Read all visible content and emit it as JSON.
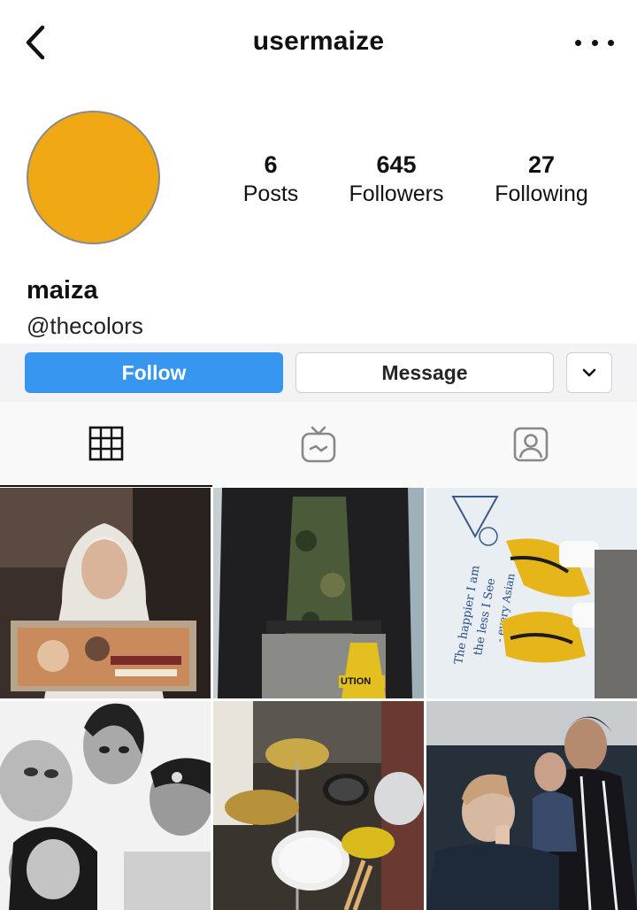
{
  "header": {
    "username": "usermaize",
    "back_icon": "chevron-left-icon",
    "more_icon": "more-horizontal-icon"
  },
  "profile": {
    "avatar_color": "#f1a815",
    "display_name": "maiza",
    "handle": "@thecolors",
    "stats": [
      {
        "value": "6",
        "label": "Posts"
      },
      {
        "value": "645",
        "label": "Followers"
      },
      {
        "value": "27",
        "label": "Following"
      }
    ]
  },
  "actions": {
    "follow_label": "Follow",
    "message_label": "Message",
    "more_icon": "chevron-down-icon",
    "follow_color": "#3797f0"
  },
  "tabs": [
    {
      "icon": "grid-icon",
      "active": true
    },
    {
      "icon": "igtv-icon",
      "active": false
    },
    {
      "icon": "tagged-user-icon",
      "active": false
    }
  ],
  "posts": {
    "count": 6,
    "thumbnail_texts": {
      "post_3_handwriting": [
        "The happier I am",
        "the less I See",
        "- every Asian"
      ],
      "post_2_sign": "UTION"
    }
  }
}
